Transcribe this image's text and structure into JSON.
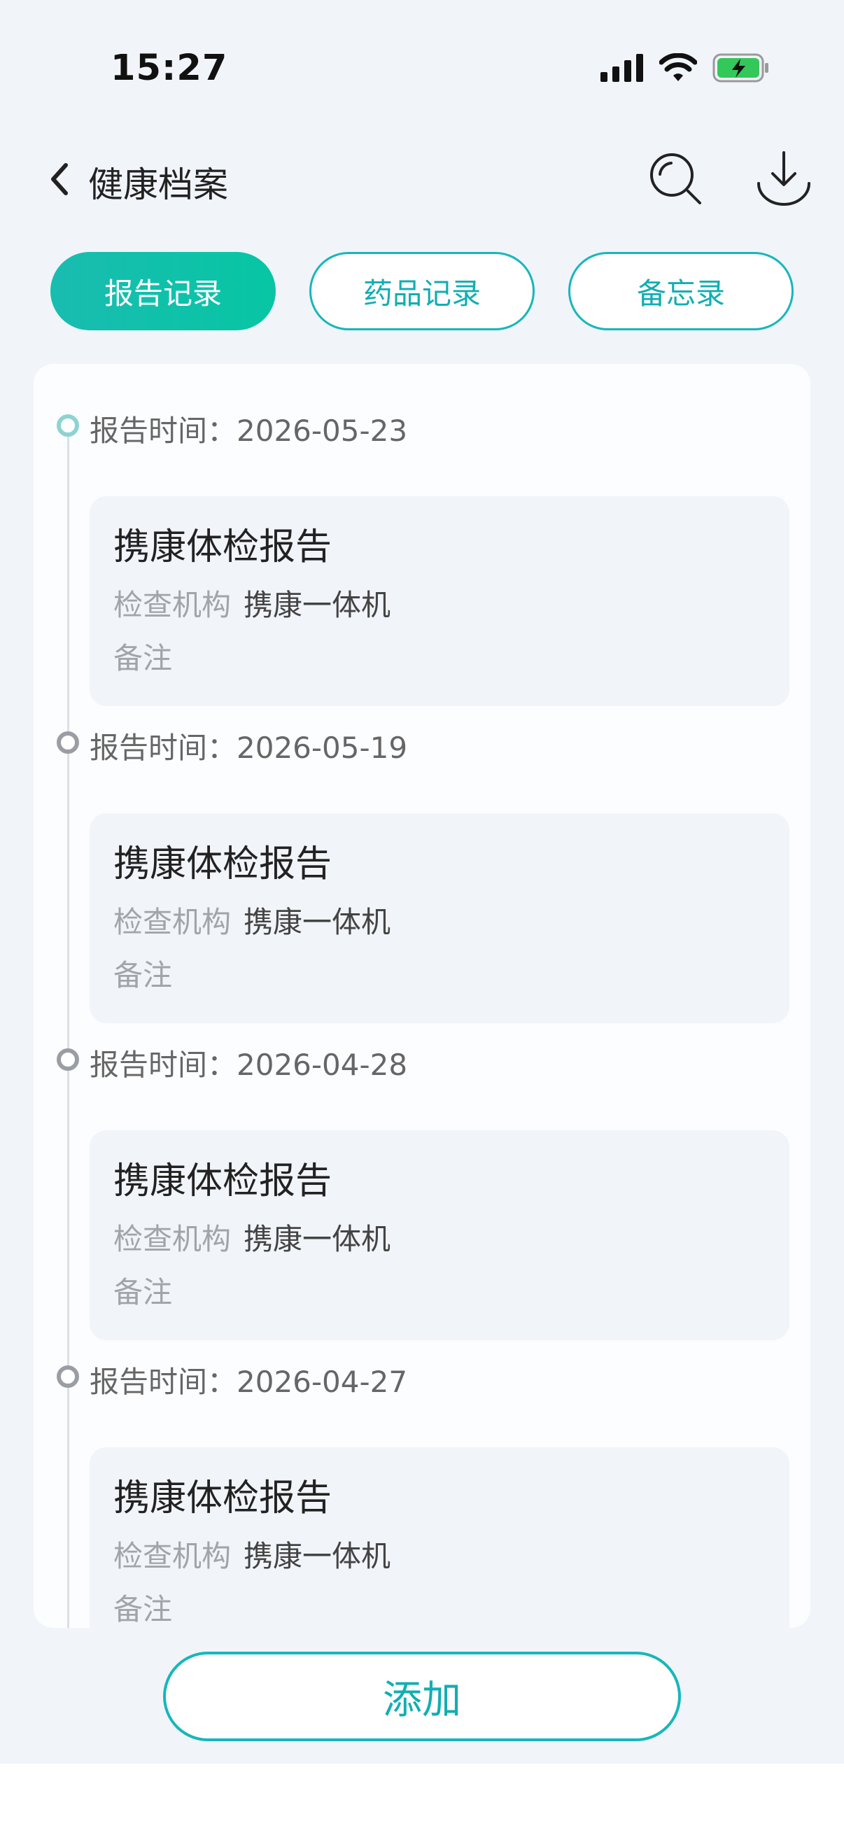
{
  "status_bar": {
    "time": "15:27",
    "icons": [
      "signal-icon",
      "wifi-icon",
      "battery-charging-icon"
    ]
  },
  "header": {
    "back_icon": "chevron-left-icon",
    "title": "健康档案",
    "search_icon": "search-icon",
    "download_icon": "download-icon"
  },
  "tabs": [
    {
      "label": "报告记录",
      "active": true
    },
    {
      "label": "药品记录",
      "active": false
    },
    {
      "label": "备忘录",
      "active": false
    }
  ],
  "records": [
    {
      "date_label": "报告时间：2026-05-23",
      "title": "携康体检报告",
      "org_key": "检查机构",
      "org_value": "携康一体机",
      "note_label": "备注"
    },
    {
      "date_label": "报告时间：2026-05-19",
      "title": "携康体检报告",
      "org_key": "检查机构",
      "org_value": "携康一体机",
      "note_label": "备注"
    },
    {
      "date_label": "报告时间：2026-04-28",
      "title": "携康体检报告",
      "org_key": "检查机构",
      "org_value": "携康一体机",
      "note_label": "备注"
    },
    {
      "date_label": "报告时间：2026-04-27",
      "title": "携康体检报告",
      "org_key": "检查机构",
      "org_value": "携康一体机",
      "note_label": "备注"
    }
  ],
  "add_button": {
    "label": "添加"
  },
  "colors": {
    "accent": "#16b7ba",
    "tab_active_gradient_start": "#19bcb0",
    "tab_active_gradient_end": "#07c6a4",
    "page_background": "#f1f4f9"
  }
}
